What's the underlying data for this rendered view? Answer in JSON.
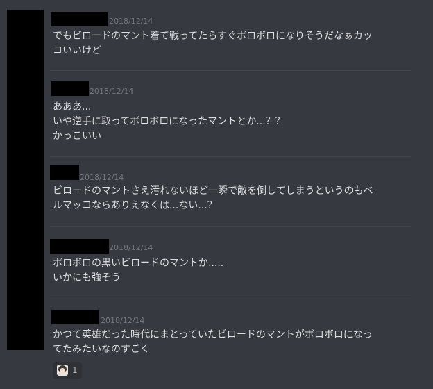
{
  "messages": [
    {
      "timestamp": "2018/12/14",
      "lines": [
        "でもビロードのマント着て戦ってたらすぐボロボロになりそうだなぁカッ",
        "コいいけど"
      ]
    },
    {
      "timestamp": "2018/12/14",
      "lines": [
        "あああ...",
        "いや逆手に取ってボロボロになったマントとか...？？",
        "かっこいい"
      ]
    },
    {
      "timestamp": "2018/12/14",
      "lines": [
        "ビロードのマントさえ汚れないほど一瞬で敵を倒してしまうというのもベ",
        "ルマッコならありえなくは...ない...？"
      ]
    },
    {
      "timestamp": "2018/12/14",
      "lines": [
        "ボロボロの黒いビロードのマントか.....",
        "いかにも強そう"
      ]
    },
    {
      "timestamp": "2018/12/14",
      "lines": [
        "かつて英雄だった時代にまとっていたビロードのマントがボロボロになっ",
        "てたみたいなのすごく"
      ]
    }
  ],
  "reaction": {
    "emoji": "character-face-emoji",
    "count": "1"
  },
  "colors": {
    "background": "#36393f",
    "text": "#dcddde",
    "timestamp": "#72767d",
    "redaction": "#000000"
  }
}
